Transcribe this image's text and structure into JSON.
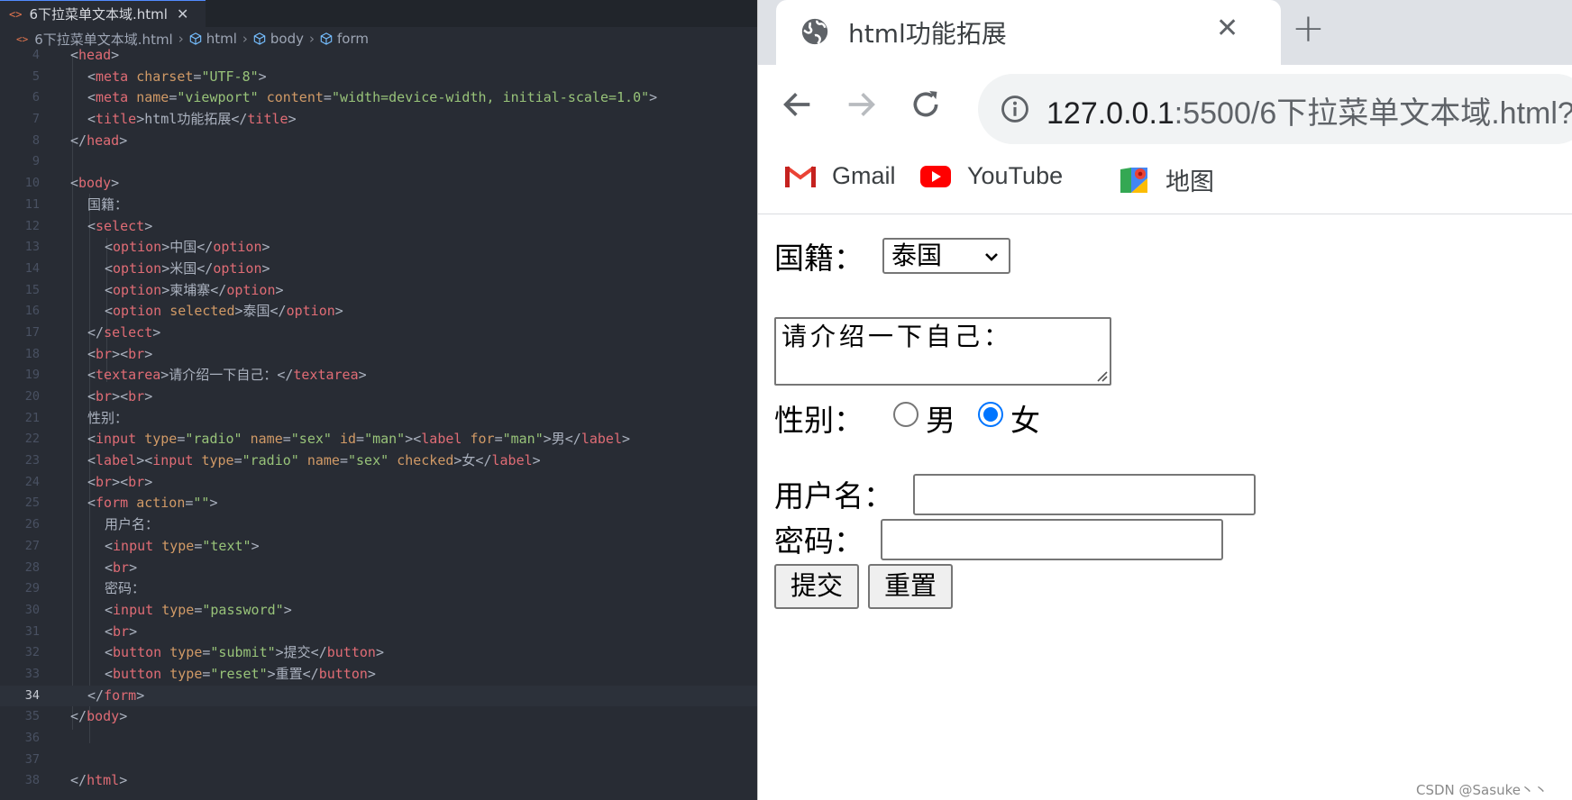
{
  "editor": {
    "tab_title": "6下拉菜单文本域.html",
    "tab_close": "✕",
    "breadcrumb": [
      "6下拉菜单文本域.html",
      "html",
      "body",
      "form"
    ],
    "current_line": "34",
    "lines": [
      {
        "n": "4",
        "indent": 0,
        "parts": [
          [
            "p",
            "<"
          ],
          [
            "t",
            "head"
          ],
          [
            "p",
            ">"
          ]
        ]
      },
      {
        "n": "5",
        "indent": 1,
        "parts": [
          [
            "p",
            "<"
          ],
          [
            "t",
            "meta"
          ],
          [
            "p",
            " "
          ],
          [
            "a",
            "charset"
          ],
          [
            "p",
            "="
          ],
          [
            "s",
            "\"UTF-8\""
          ],
          [
            "p",
            ">"
          ]
        ]
      },
      {
        "n": "6",
        "indent": 1,
        "parts": [
          [
            "p",
            "<"
          ],
          [
            "t",
            "meta"
          ],
          [
            "p",
            " "
          ],
          [
            "a",
            "name"
          ],
          [
            "p",
            "="
          ],
          [
            "s",
            "\"viewport\""
          ],
          [
            "p",
            " "
          ],
          [
            "a",
            "content"
          ],
          [
            "p",
            "="
          ],
          [
            "s",
            "\"width=device-width, initial-scale=1.0\""
          ],
          [
            "p",
            ">"
          ]
        ]
      },
      {
        "n": "7",
        "indent": 1,
        "parts": [
          [
            "p",
            "<"
          ],
          [
            "t",
            "title"
          ],
          [
            "p",
            ">html功能拓展</"
          ],
          [
            "t",
            "title"
          ],
          [
            "p",
            ">"
          ]
        ]
      },
      {
        "n": "8",
        "indent": 0,
        "parts": [
          [
            "p",
            "</"
          ],
          [
            "t",
            "head"
          ],
          [
            "p",
            ">"
          ]
        ]
      },
      {
        "n": "9",
        "indent": 0,
        "parts": []
      },
      {
        "n": "10",
        "indent": 0,
        "parts": [
          [
            "p",
            "<"
          ],
          [
            "t",
            "body"
          ],
          [
            "p",
            ">"
          ]
        ]
      },
      {
        "n": "11",
        "indent": 1,
        "parts": [
          [
            "p",
            "国籍："
          ]
        ]
      },
      {
        "n": "12",
        "indent": 1,
        "parts": [
          [
            "p",
            "<"
          ],
          [
            "t",
            "select"
          ],
          [
            "p",
            ">"
          ]
        ]
      },
      {
        "n": "13",
        "indent": 2,
        "parts": [
          [
            "p",
            "<"
          ],
          [
            "t",
            "option"
          ],
          [
            "p",
            ">中国</"
          ],
          [
            "t",
            "option"
          ],
          [
            "p",
            ">"
          ]
        ]
      },
      {
        "n": "14",
        "indent": 2,
        "parts": [
          [
            "p",
            "<"
          ],
          [
            "t",
            "option"
          ],
          [
            "p",
            ">米国</"
          ],
          [
            "t",
            "option"
          ],
          [
            "p",
            ">"
          ]
        ]
      },
      {
        "n": "15",
        "indent": 2,
        "parts": [
          [
            "p",
            "<"
          ],
          [
            "t",
            "option"
          ],
          [
            "p",
            ">柬埔寨</"
          ],
          [
            "t",
            "option"
          ],
          [
            "p",
            ">"
          ]
        ]
      },
      {
        "n": "16",
        "indent": 2,
        "parts": [
          [
            "p",
            "<"
          ],
          [
            "t",
            "option"
          ],
          [
            "p",
            " "
          ],
          [
            "a",
            "selected"
          ],
          [
            "p",
            ">泰国</"
          ],
          [
            "t",
            "option"
          ],
          [
            "p",
            ">"
          ]
        ]
      },
      {
        "n": "17",
        "indent": 1,
        "parts": [
          [
            "p",
            "</"
          ],
          [
            "t",
            "select"
          ],
          [
            "p",
            ">"
          ]
        ]
      },
      {
        "n": "18",
        "indent": 1,
        "parts": [
          [
            "p",
            "<"
          ],
          [
            "t",
            "br"
          ],
          [
            "p",
            "><"
          ],
          [
            "t",
            "br"
          ],
          [
            "p",
            ">"
          ]
        ]
      },
      {
        "n": "19",
        "indent": 1,
        "parts": [
          [
            "p",
            "<"
          ],
          [
            "t",
            "textarea"
          ],
          [
            "p",
            ">请介绍一下自己：</"
          ],
          [
            "t",
            "textarea"
          ],
          [
            "p",
            ">"
          ]
        ]
      },
      {
        "n": "20",
        "indent": 1,
        "parts": [
          [
            "p",
            "<"
          ],
          [
            "t",
            "br"
          ],
          [
            "p",
            "><"
          ],
          [
            "t",
            "br"
          ],
          [
            "p",
            ">"
          ]
        ]
      },
      {
        "n": "21",
        "indent": 1,
        "parts": [
          [
            "p",
            "性别："
          ]
        ]
      },
      {
        "n": "22",
        "indent": 1,
        "parts": [
          [
            "p",
            "<"
          ],
          [
            "t",
            "input"
          ],
          [
            "p",
            " "
          ],
          [
            "a",
            "type"
          ],
          [
            "p",
            "="
          ],
          [
            "s",
            "\"radio\""
          ],
          [
            "p",
            " "
          ],
          [
            "a",
            "name"
          ],
          [
            "p",
            "="
          ],
          [
            "s",
            "\"sex\""
          ],
          [
            "p",
            " "
          ],
          [
            "a",
            "id"
          ],
          [
            "p",
            "="
          ],
          [
            "s",
            "\"man\""
          ],
          [
            "p",
            "><"
          ],
          [
            "t",
            "label"
          ],
          [
            "p",
            " "
          ],
          [
            "a",
            "for"
          ],
          [
            "p",
            "="
          ],
          [
            "s",
            "\"man\""
          ],
          [
            "p",
            ">男</"
          ],
          [
            "t",
            "label"
          ],
          [
            "p",
            ">"
          ]
        ]
      },
      {
        "n": "23",
        "indent": 1,
        "parts": [
          [
            "p",
            "<"
          ],
          [
            "t",
            "label"
          ],
          [
            "p",
            "><"
          ],
          [
            "t",
            "input"
          ],
          [
            "p",
            " "
          ],
          [
            "a",
            "type"
          ],
          [
            "p",
            "="
          ],
          [
            "s",
            "\"radio\""
          ],
          [
            "p",
            " "
          ],
          [
            "a",
            "name"
          ],
          [
            "p",
            "="
          ],
          [
            "s",
            "\"sex\""
          ],
          [
            "p",
            " "
          ],
          [
            "a",
            "checked"
          ],
          [
            "p",
            ">女</"
          ],
          [
            "t",
            "label"
          ],
          [
            "p",
            ">"
          ]
        ]
      },
      {
        "n": "24",
        "indent": 1,
        "parts": [
          [
            "p",
            "<"
          ],
          [
            "t",
            "br"
          ],
          [
            "p",
            "><"
          ],
          [
            "t",
            "br"
          ],
          [
            "p",
            ">"
          ]
        ]
      },
      {
        "n": "25",
        "indent": 1,
        "parts": [
          [
            "p",
            "<"
          ],
          [
            "t",
            "form"
          ],
          [
            "p",
            " "
          ],
          [
            "a",
            "action"
          ],
          [
            "p",
            "="
          ],
          [
            "s",
            "\"\""
          ],
          [
            "p",
            ">"
          ]
        ]
      },
      {
        "n": "26",
        "indent": 2,
        "parts": [
          [
            "p",
            "用户名："
          ]
        ]
      },
      {
        "n": "27",
        "indent": 2,
        "parts": [
          [
            "p",
            "<"
          ],
          [
            "t",
            "input"
          ],
          [
            "p",
            " "
          ],
          [
            "a",
            "type"
          ],
          [
            "p",
            "="
          ],
          [
            "s",
            "\"text\""
          ],
          [
            "p",
            ">"
          ]
        ]
      },
      {
        "n": "28",
        "indent": 2,
        "parts": [
          [
            "p",
            "<"
          ],
          [
            "t",
            "br"
          ],
          [
            "p",
            ">"
          ]
        ]
      },
      {
        "n": "29",
        "indent": 2,
        "parts": [
          [
            "p",
            "密码："
          ]
        ]
      },
      {
        "n": "30",
        "indent": 2,
        "parts": [
          [
            "p",
            "<"
          ],
          [
            "t",
            "input"
          ],
          [
            "p",
            " "
          ],
          [
            "a",
            "type"
          ],
          [
            "p",
            "="
          ],
          [
            "s",
            "\"password\""
          ],
          [
            "p",
            ">"
          ]
        ]
      },
      {
        "n": "31",
        "indent": 2,
        "parts": [
          [
            "p",
            "<"
          ],
          [
            "t",
            "br"
          ],
          [
            "p",
            ">"
          ]
        ]
      },
      {
        "n": "32",
        "indent": 2,
        "parts": [
          [
            "p",
            "<"
          ],
          [
            "t",
            "button"
          ],
          [
            "p",
            " "
          ],
          [
            "a",
            "type"
          ],
          [
            "p",
            "="
          ],
          [
            "s",
            "\"submit\""
          ],
          [
            "p",
            ">提交</"
          ],
          [
            "t",
            "button"
          ],
          [
            "p",
            ">"
          ]
        ]
      },
      {
        "n": "33",
        "indent": 2,
        "parts": [
          [
            "p",
            "<"
          ],
          [
            "t",
            "button"
          ],
          [
            "p",
            " "
          ],
          [
            "a",
            "type"
          ],
          [
            "p",
            "="
          ],
          [
            "s",
            "\"reset\""
          ],
          [
            "p",
            ">重置</"
          ],
          [
            "t",
            "button"
          ],
          [
            "p",
            ">"
          ]
        ]
      },
      {
        "n": "34",
        "indent": 1,
        "parts": [
          [
            "p",
            "</"
          ],
          [
            "t",
            "form"
          ],
          [
            "p",
            ">"
          ]
        ]
      },
      {
        "n": "35",
        "indent": 0,
        "parts": [
          [
            "p",
            "</"
          ],
          [
            "t",
            "body"
          ],
          [
            "p",
            ">"
          ]
        ]
      },
      {
        "n": "36",
        "indent": 0,
        "parts": []
      },
      {
        "n": "37",
        "indent": 0,
        "parts": []
      },
      {
        "n": "38",
        "indent": 0,
        "parts": [
          [
            "p",
            "</"
          ],
          [
            "t",
            "html"
          ],
          [
            "p",
            ">"
          ]
        ]
      }
    ]
  },
  "browser": {
    "tab_title": "html功能拓展",
    "tab_close": "✕",
    "new_tab": "+",
    "url_host": "127.0.0.1",
    "url_path": ":5500/6下拉菜单文本域.html?",
    "bookmarks": [
      "Gmail",
      "YouTube",
      "地图"
    ]
  },
  "page": {
    "nationality_label": "国籍：",
    "nationality_selected": "泰国",
    "textarea_value": "请介绍一下自己：",
    "gender_label": "性别：",
    "gender_male": "男",
    "gender_female": "女",
    "gender_checked": "女",
    "username_label": "用户名：",
    "password_label": "密码：",
    "submit_label": "提交",
    "reset_label": "重置"
  },
  "watermark": "CSDN @Sasuke丶丶",
  "colors": {
    "editor_bg": "#282c34",
    "tag": "#e06c75",
    "attr": "#d19a66",
    "string": "#98c379",
    "radio_accent": "#0075ff"
  }
}
